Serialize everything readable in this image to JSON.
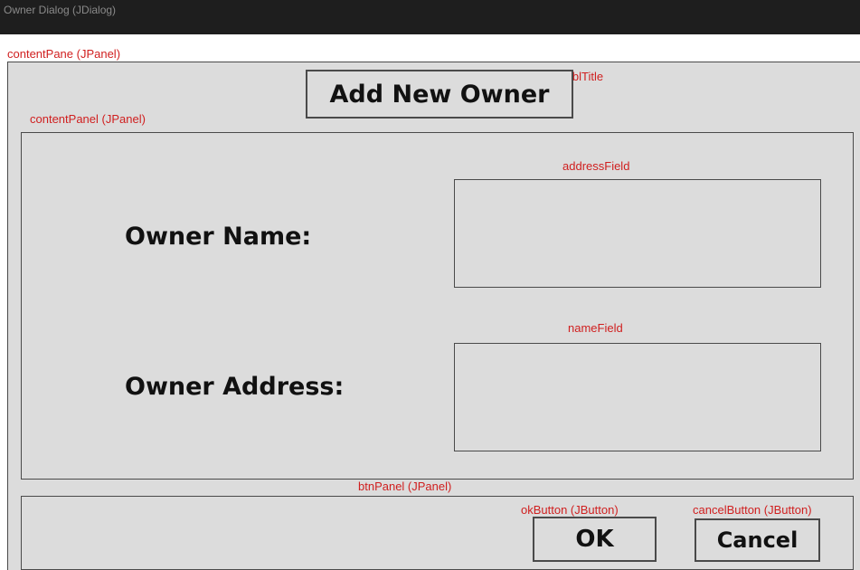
{
  "window": {
    "title": "Owner Dialog (JDialog)"
  },
  "annotations": {
    "content_pane": "contentPane (JPanel)",
    "title_label": "lblTitle",
    "content_panel": "contentPanel (JPanel)",
    "address_field": "addressField",
    "name_field": "nameField",
    "btn_panel": "btnPanel (JPanel)",
    "ok_button": "okButton (JButton)",
    "cancel_button": "cancelButton (JButton)"
  },
  "form": {
    "title": "Add New Owner",
    "owner_name_label": "Owner Name:",
    "owner_address_label": "Owner Address:",
    "address_field_value": "",
    "name_field_value": ""
  },
  "buttons": {
    "ok_label": "OK",
    "cancel_label": "Cancel"
  },
  "colors": {
    "annotation": "#d01f1f",
    "panel_background": "#dcdcdc",
    "titlebar": "#1e1e1e"
  }
}
